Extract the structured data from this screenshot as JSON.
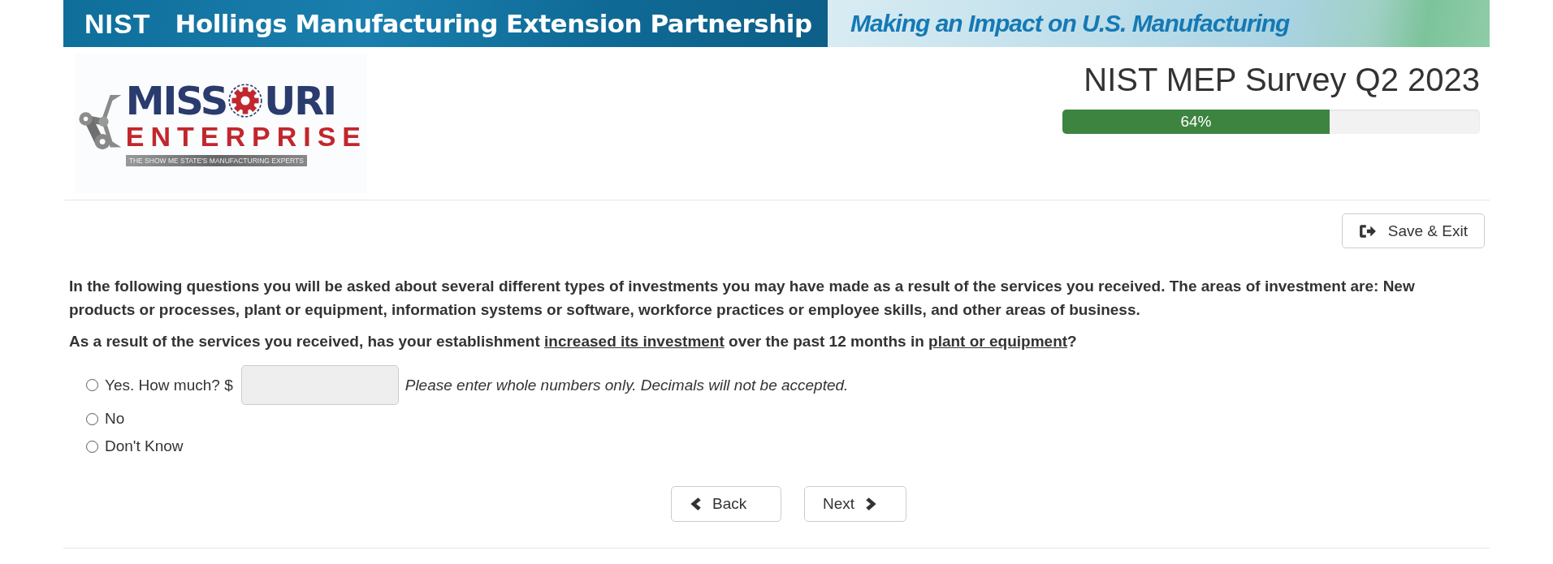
{
  "banner": {
    "logo_text": "NIST",
    "title": "Hollings Manufacturing Extension Partnership",
    "tagline": "Making an Impact on U.S. Manufacturing"
  },
  "logo": {
    "word_start": "MISS",
    "word_end": "URI",
    "word2": "ENTERPRISE",
    "motto": "THE SHOW ME STATE'S MANUFACTURING EXPERTS"
  },
  "survey": {
    "title": "NIST MEP Survey Q2 2023",
    "progress": {
      "level": 0.64,
      "label": "64%"
    }
  },
  "save_exit": {
    "label": "Save & Exit"
  },
  "intro": "In the following questions you will be asked about several different types of investments you may have made as a result of the services you received. The areas of investment are: New products or processes, plant or equipment, information systems or software, workforce practices or employee skills, and other areas of business.",
  "question": [
    {
      "text": "As a result of the services you received, has your establishment ",
      "underlined": false
    },
    {
      "text": "increased its investment",
      "underlined": true
    },
    {
      "text": " over the past 12 months in ",
      "underlined": false
    },
    {
      "text": "plant or equipment",
      "underlined": true
    },
    {
      "text": "?",
      "underlined": false
    }
  ],
  "options": [
    {
      "kind": "amount",
      "label": "Yes. How much? $",
      "hint": "Please enter whole numbers only. Decimals will not be accepted.",
      "selected": false
    },
    {
      "kind": "plain",
      "label": "No",
      "selected": false
    },
    {
      "kind": "plain",
      "label": "Don't Know",
      "selected": false
    }
  ],
  "nav": [
    {
      "kind": "back",
      "label": "Back"
    },
    {
      "kind": "next",
      "label": "Next"
    }
  ]
}
